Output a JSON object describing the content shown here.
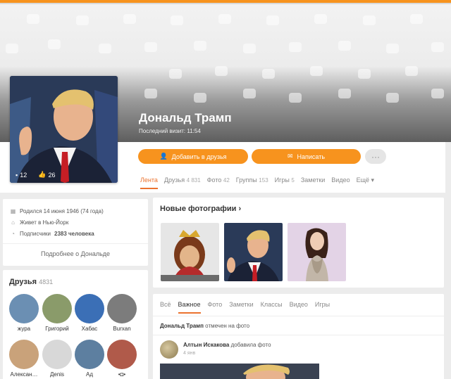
{
  "profile": {
    "name": "Дональд Трамп",
    "last_visit": "Последний визит: 11:54",
    "avatar_comments": "12",
    "avatar_likes": "26"
  },
  "actions": {
    "add_friend": "Добавить в друзья",
    "write": "Написать",
    "more": "···"
  },
  "tabs": [
    {
      "label": "Лента",
      "count": ""
    },
    {
      "label": "Друзья",
      "count": "4 831"
    },
    {
      "label": "Фото",
      "count": "42"
    },
    {
      "label": "Группы",
      "count": "153"
    },
    {
      "label": "Игры",
      "count": "5"
    },
    {
      "label": "Заметки",
      "count": ""
    },
    {
      "label": "Видео",
      "count": ""
    },
    {
      "label": "Ещё ▾",
      "count": ""
    }
  ],
  "info": {
    "born": "Родился 14 июня 1946 (74 года)",
    "lives": "Живет в Нью-Йорк",
    "subscribers_prefix": "Подписчики",
    "subscribers_value": "2383 человека",
    "more_link": "Подробнее о Дональде"
  },
  "friends": {
    "title": "Друзья",
    "count": "4831",
    "items": [
      {
        "name": "жура",
        "color": "#6b8fb3"
      },
      {
        "name": "Григорий",
        "color": "#8a9b6a"
      },
      {
        "name": "Хабас",
        "color": "#3b6fb6"
      },
      {
        "name": "Burxan",
        "color": "#7c7c7c"
      },
      {
        "name": "Алексан…",
        "color": "#c9a27a"
      },
      {
        "name": "Деnis",
        "color": "#d8d8d8"
      },
      {
        "name": "Ад",
        "color": "#5d7fa0"
      },
      {
        "name": "•◘•",
        "color": "#b05a4a"
      }
    ]
  },
  "photos": {
    "title": "Новые фотографии",
    "chevron": "›"
  },
  "feed": {
    "tabs": [
      "Всё",
      "Важное",
      "Фото",
      "Заметки",
      "Классы",
      "Видео",
      "Игры"
    ],
    "note_name": "Дональд Трамп",
    "note_text": "отмечен на фото",
    "post_author": "Алтын Искакова",
    "post_action": "добавила фото",
    "post_time": "4 янв"
  },
  "colors": {
    "accent": "#f7931e",
    "tab_active": "#eb722e"
  }
}
